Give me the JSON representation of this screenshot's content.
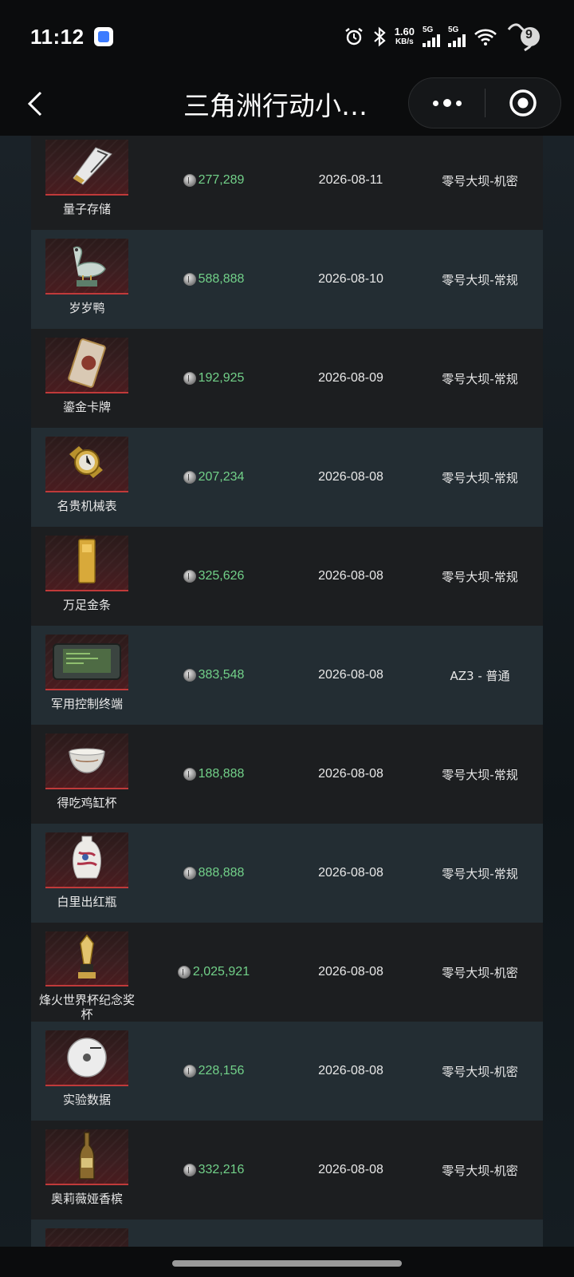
{
  "status_bar": {
    "time": "11:12",
    "net_speed_value": "1.60",
    "net_speed_unit": "KB/s",
    "signal1_label": "5G",
    "signal2_label": "5G",
    "battery_level": "9"
  },
  "nav": {
    "title": "三角洲行动小…"
  },
  "records": [
    {
      "name": "量子存储",
      "icon": "quantum-storage-icon",
      "price": "277,289",
      "date": "2026-08-11",
      "map": "零号大坝-机密"
    },
    {
      "name": "岁岁鸭",
      "icon": "duck-statue-icon",
      "price": "588,888",
      "date": "2026-08-10",
      "map": "零号大坝-常规"
    },
    {
      "name": "鎏金卡牌",
      "icon": "gilded-card-icon",
      "price": "192,925",
      "date": "2026-08-09",
      "map": "零号大坝-常规"
    },
    {
      "name": "名贵机械表",
      "icon": "watch-icon",
      "price": "207,234",
      "date": "2026-08-08",
      "map": "零号大坝-常规"
    },
    {
      "name": "万足金条",
      "icon": "gold-bar-icon",
      "price": "325,626",
      "date": "2026-08-08",
      "map": "零号大坝-常规"
    },
    {
      "name": "军用控制终端",
      "icon": "control-terminal-icon",
      "price": "383,548",
      "date": "2026-08-08",
      "map": "AZ3 - 普通"
    },
    {
      "name": "得吃鸡缸杯",
      "icon": "cup-icon",
      "price": "188,888",
      "date": "2026-08-08",
      "map": "零号大坝-常规"
    },
    {
      "name": "白里出红瓶",
      "icon": "vase-icon",
      "price": "888,888",
      "date": "2026-08-08",
      "map": "零号大坝-常规"
    },
    {
      "name": "烽火世界杯纪念奖杯",
      "icon": "trophy-icon",
      "price": "2,025,921",
      "date": "2026-08-08",
      "map": "零号大坝-机密"
    },
    {
      "name": "实验数据",
      "icon": "disc-icon",
      "price": "228,156",
      "date": "2026-08-08",
      "map": "零号大坝-机密"
    },
    {
      "name": "奥莉薇娅香槟",
      "icon": "champagne-icon",
      "price": "332,216",
      "date": "2026-08-08",
      "map": "零号大坝-机密"
    },
    {
      "name": "",
      "icon": "item-icon",
      "price": "",
      "date": "",
      "map": ""
    }
  ]
}
